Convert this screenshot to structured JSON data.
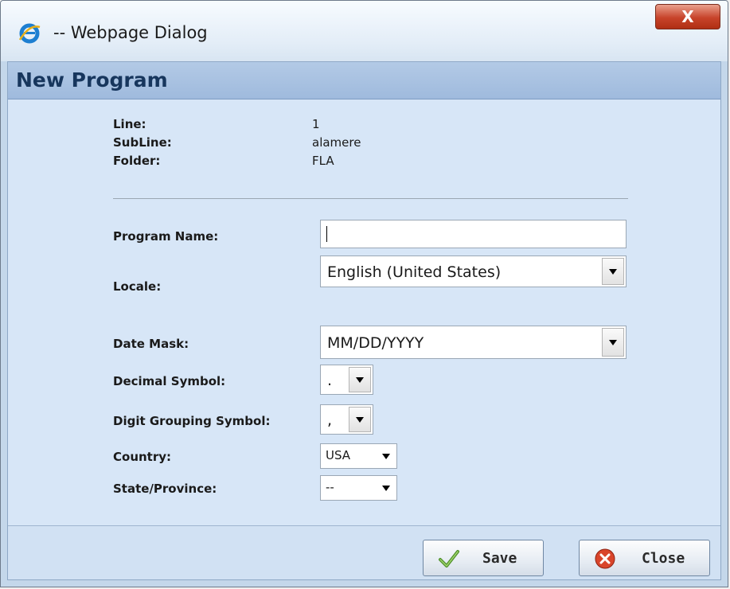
{
  "window": {
    "title": "-- Webpage Dialog",
    "close_glyph": "X"
  },
  "dialog": {
    "header": "New Program"
  },
  "info": {
    "line_label": "Line:",
    "line_value": "1",
    "subline_label": "SubLine:",
    "subline_value": "alamere",
    "folder_label": "Folder:",
    "folder_value": "FLA"
  },
  "form": {
    "program_name_label": "Program Name:",
    "program_name_value": "",
    "locale_label": "Locale:",
    "locale_value": "English (United States)",
    "date_mask_label": "Date Mask:",
    "date_mask_value": "MM/DD/YYYY",
    "decimal_label": "Decimal Symbol:",
    "decimal_value": ".",
    "digit_group_label": "Digit Grouping Symbol:",
    "digit_group_value": ",",
    "country_label": "Country:",
    "country_value": "USA",
    "state_label": "State/Province:",
    "state_value": "--"
  },
  "buttons": {
    "save": "Save",
    "close": "Close"
  },
  "icons": {
    "app": "ie-icon",
    "save": "checkmark-icon",
    "close": "close-circle-icon"
  },
  "colors": {
    "header_text": "#17365d",
    "panel_bg": "#d7e6f7",
    "close_button": "#c7432a"
  }
}
